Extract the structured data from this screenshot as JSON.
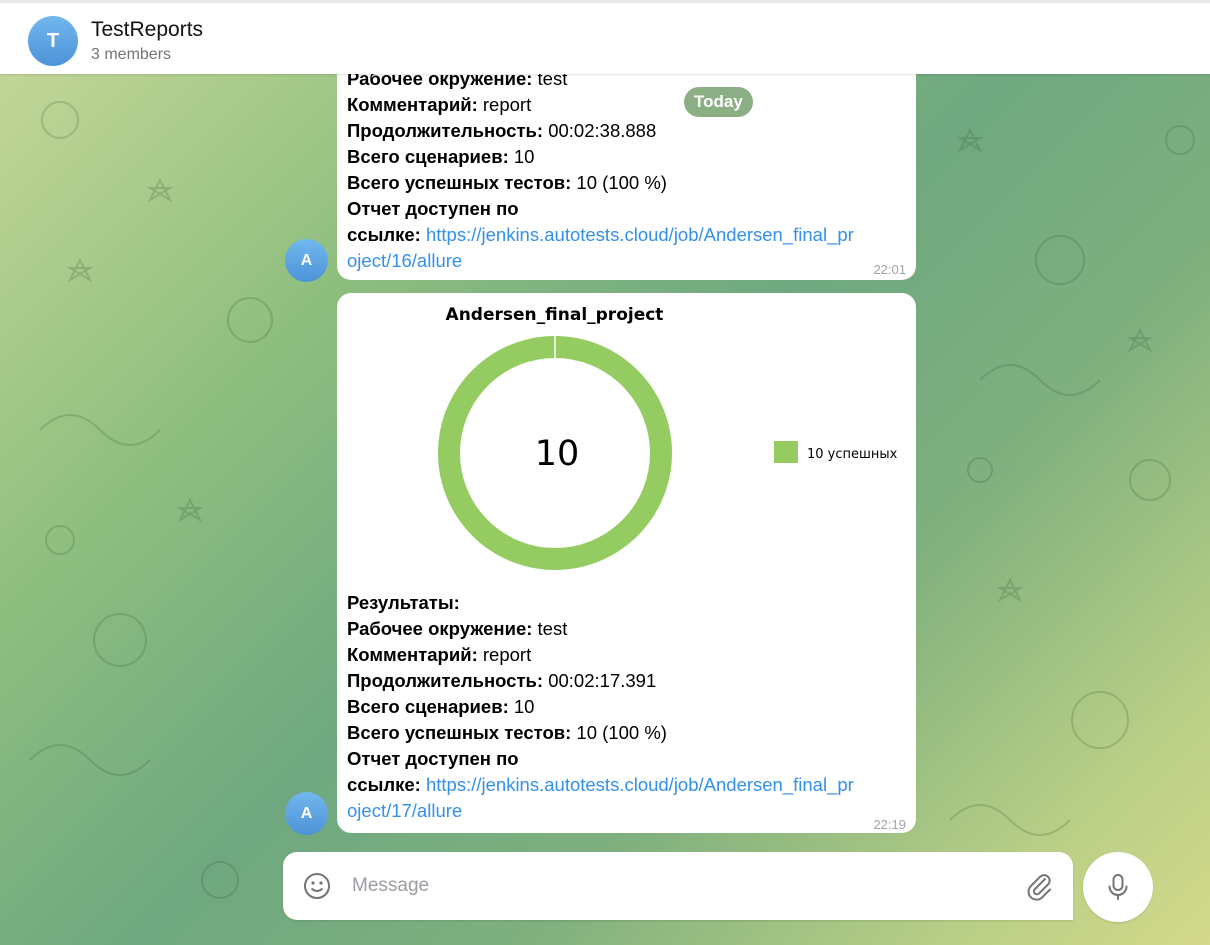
{
  "header": {
    "avatar_letter": "T",
    "title": "TestReports",
    "subtitle": "3 members"
  },
  "date_badge": "Today",
  "messages": [
    {
      "sender_initial": "A",
      "lines": [
        {
          "label": "Рабочее окружение:",
          "value": " test"
        },
        {
          "label": "Комментарий:",
          "value": " report"
        },
        {
          "label": "Продолжительность:",
          "value": " 00:02:38.888"
        },
        {
          "label": "Всего сценариев:",
          "value": " 10"
        },
        {
          "label": "Всего успешных тестов:",
          "value": " 10 (100 %)"
        },
        {
          "label": "Отчет доступен по",
          "value": ""
        }
      ],
      "link_label": "ссылке:",
      "link_line1": "https://jenkins.autotests.cloud/job/Andersen_final_pr",
      "link_line2": "oject/16/allure",
      "time": "22:01"
    },
    {
      "sender_initial": "A",
      "results_label": "Результаты:",
      "lines": [
        {
          "label": "Рабочее окружение:",
          "value": " test"
        },
        {
          "label": "Комментарий:",
          "value": " report"
        },
        {
          "label": "Продолжительность:",
          "value": " 00:02:17.391"
        },
        {
          "label": "Всего сценариев:",
          "value": " 10"
        },
        {
          "label": "Всего успешных тестов:",
          "value": " 10 (100 %)"
        },
        {
          "label": "Отчет доступен по",
          "value": ""
        }
      ],
      "link_label": "ссылке:",
      "link_line1": "https://jenkins.autotests.cloud/job/Andersen_final_pr",
      "link_line2": "oject/17/allure",
      "time": "22:19"
    }
  ],
  "chart_data": {
    "type": "pie",
    "title": "Andersen_final_project",
    "center_label": "10",
    "slices": [
      {
        "label": "10 успешных",
        "value": 10,
        "color": "#94cc61"
      }
    ],
    "legend_position": "right"
  },
  "composer": {
    "placeholder": "Message",
    "emoji_icon": "smile-icon",
    "attach_icon": "paperclip-icon",
    "mic_icon": "microphone-icon"
  },
  "colors": {
    "link": "#3390ec",
    "accent_avatar": "#5aa2e2",
    "donut": "#94cc61"
  }
}
